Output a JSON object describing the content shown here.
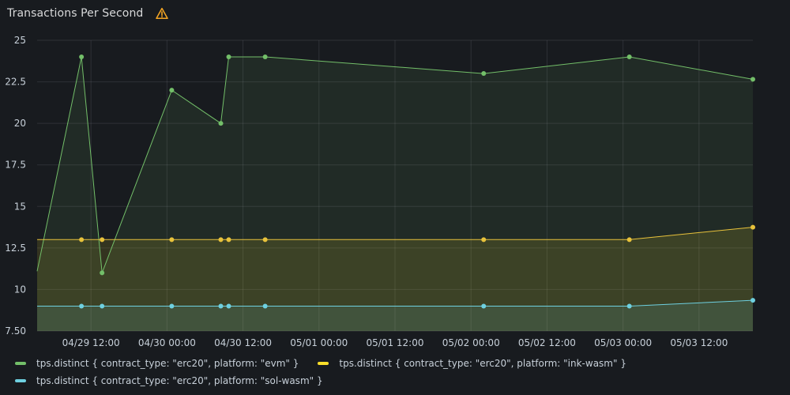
{
  "panel": {
    "title": "Transactions Per Second",
    "warning_icon": "warning-triangle-icon",
    "warning_color": "#f5a623"
  },
  "chart_data": {
    "type": "area",
    "y_ticks": [
      "25",
      "22.5",
      "20",
      "17.5",
      "15",
      "12.5",
      "10",
      "7.50"
    ],
    "y_tick_values": [
      25,
      22.5,
      20,
      17.5,
      15,
      12.5,
      10,
      7.5
    ],
    "ylim": [
      7.5,
      25
    ],
    "x_ticks": [
      "04/29 12:00",
      "04/30 00:00",
      "04/30 12:00",
      "05/01 00:00",
      "05/01 12:00",
      "05/02 00:00",
      "05/02 12:00",
      "05/03 00:00",
      "05/03 12:00"
    ],
    "x_tick_times": [
      "2024-04-29T12:00",
      "2024-04-30T00:00",
      "2024-04-30T12:00",
      "2024-05-01T00:00",
      "2024-05-01T12:00",
      "2024-05-02T00:00",
      "2024-05-02T12:00",
      "2024-05-03T00:00",
      "2024-05-03T12:00"
    ],
    "xlim": [
      "2024-04-29T03:30",
      "2024-05-03T20:30"
    ],
    "grid": true,
    "legend_placement": "bottom",
    "series": [
      {
        "name": "tps.distinct { contract_type: \"erc20\", platform: \"evm\" }",
        "color": "#73bf69",
        "x": [
          "2024-04-29T03:30",
          "2024-04-29T10:30",
          "2024-04-29T13:45",
          "2024-04-30T00:45",
          "2024-04-30T08:30",
          "2024-04-30T09:45",
          "2024-04-30T15:30",
          "2024-05-02T02:00",
          "2024-05-03T01:00",
          "2024-05-03T20:30"
        ],
        "values": [
          11.1,
          24,
          11,
          22,
          20,
          24,
          24,
          23,
          24,
          22.65
        ]
      },
      {
        "name": "tps.distinct { contract_type: \"erc20\", platform: \"ink-wasm\" }",
        "color": "#fade2a",
        "x": [
          "2024-04-29T03:30",
          "2024-04-29T10:30",
          "2024-04-29T13:45",
          "2024-04-30T00:45",
          "2024-04-30T08:30",
          "2024-04-30T09:45",
          "2024-04-30T15:30",
          "2024-05-02T02:00",
          "2024-05-03T01:00",
          "2024-05-03T20:30"
        ],
        "values": [
          13,
          13,
          13,
          13,
          13,
          13,
          13,
          13,
          13,
          13.75
        ]
      },
      {
        "name": "tps.distinct { contract_type: \"erc20\", platform: \"sol-wasm\" }",
        "color": "#8ab8ff",
        "x": [
          "2024-04-29T03:30",
          "2024-04-29T10:30",
          "2024-04-29T13:45",
          "2024-04-30T00:45",
          "2024-04-30T08:30",
          "2024-04-30T09:45",
          "2024-04-30T15:30",
          "2024-05-02T02:00",
          "2024-05-03T01:00",
          "2024-05-03T20:30"
        ],
        "values": [
          9,
          9,
          9,
          9,
          9,
          9,
          9,
          9,
          9,
          9.35
        ]
      }
    ],
    "first_point_marker": false
  },
  "legend": [
    {
      "label": "tps.distinct { contract_type: \"erc20\", platform: \"evm\" }",
      "color": "#73bf69"
    },
    {
      "label": "tps.distinct { contract_type: \"erc20\", platform: \"ink-wasm\" }",
      "color": "#fade2a"
    },
    {
      "label": "tps.distinct { contract_type: \"erc20\", platform: \"sol-wasm\" }",
      "color": "#6ed0e0"
    }
  ]
}
